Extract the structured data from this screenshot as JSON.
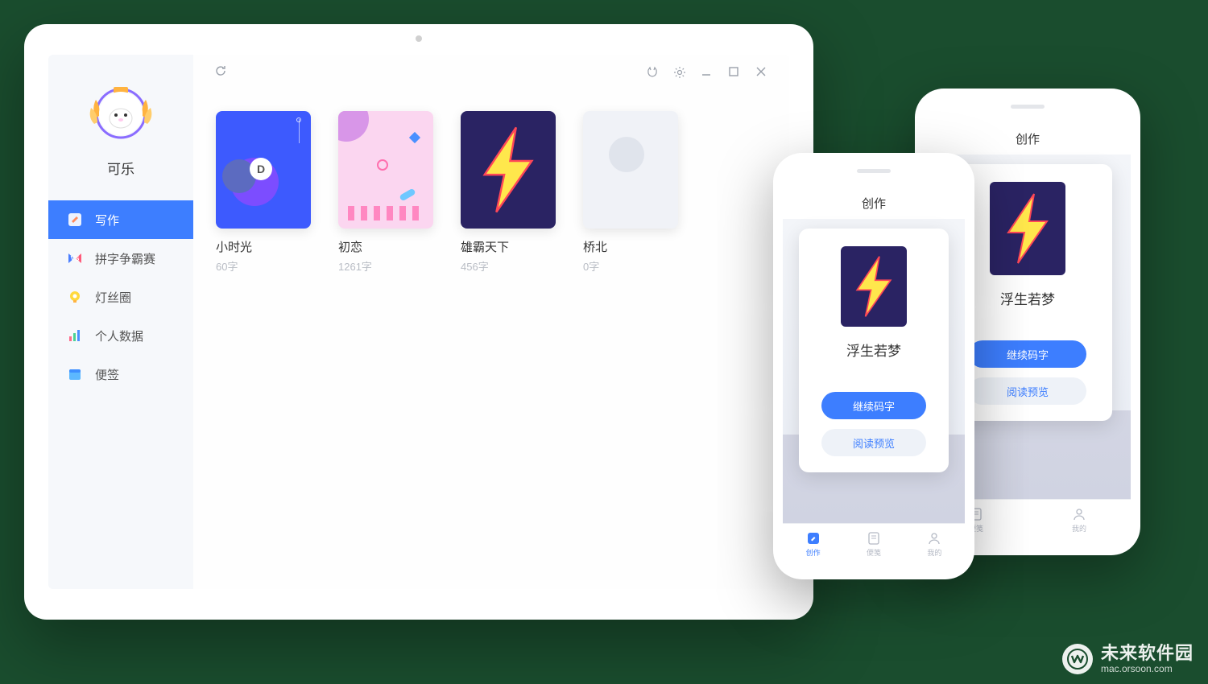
{
  "sidebar": {
    "username": "可乐",
    "items": [
      {
        "label": "写作",
        "icon": "compose-icon",
        "active": true
      },
      {
        "label": "拼字争霸赛",
        "icon": "versus-icon",
        "active": false
      },
      {
        "label": "灯丝圈",
        "icon": "bulb-icon",
        "active": false
      },
      {
        "label": "个人数据",
        "icon": "chart-icon",
        "active": false
      },
      {
        "label": "便签",
        "icon": "note-icon",
        "active": false
      }
    ]
  },
  "topbar": {
    "icons": {
      "refresh": "refresh-icon",
      "cat": "cat-icon",
      "settings": "gear-icon",
      "minimize": "minimize-icon",
      "maximize": "maximize-icon",
      "close": "close-icon"
    }
  },
  "books": [
    {
      "title": "小时光",
      "meta": "60字",
      "cover_badge": "D"
    },
    {
      "title": "初恋",
      "meta": "1261字"
    },
    {
      "title": "雄霸天下",
      "meta": "456字"
    },
    {
      "title": "桥北",
      "meta": "0字"
    }
  ],
  "phone": {
    "header": "创作",
    "card_title": "浮生若梦",
    "primary_btn": "继续码字",
    "secondary_btn": "阅读预览",
    "tabs": [
      {
        "label": "创作",
        "active": true
      },
      {
        "label": "便笺",
        "active": false
      },
      {
        "label": "我的",
        "active": false
      }
    ]
  },
  "watermark": {
    "main": "未来软件园",
    "sub": "mac.orsoon.com"
  },
  "colors": {
    "accent": "#3d7eff",
    "navy": "#2a2363",
    "bolt_fill": "#ffe74c",
    "bolt_stroke": "#ff4757"
  }
}
